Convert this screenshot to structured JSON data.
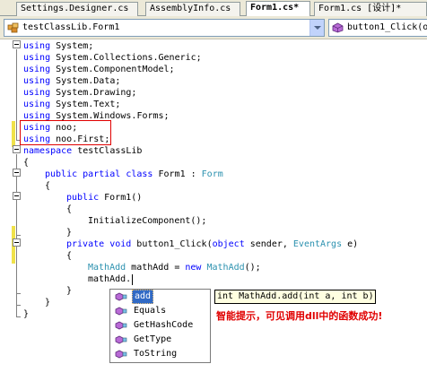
{
  "tabs": [
    {
      "label": "Settings.Designer.cs",
      "active": false
    },
    {
      "label": "AssemblyInfo.cs",
      "active": false
    },
    {
      "label": "Form1.cs*",
      "active": true
    },
    {
      "label": "Form1.cs [设计]*",
      "active": false
    }
  ],
  "navbar": {
    "class_combo": "testClassLib.Form1",
    "member_combo": "button1_Click(o"
  },
  "code": {
    "l1": [
      "using",
      " System;"
    ],
    "l2": [
      "using",
      " System.Collections.Generic;"
    ],
    "l3": [
      "using",
      " System.ComponentModel;"
    ],
    "l4": [
      "using",
      " System.Data;"
    ],
    "l5": [
      "using",
      " System.Drawing;"
    ],
    "l6": [
      "using",
      " System.Text;"
    ],
    "l7": [
      "using",
      " System.Windows.Forms;"
    ],
    "l8": [
      "using",
      " noo;"
    ],
    "l9": [
      "using",
      " noo.First;"
    ],
    "l10": [
      "namespace",
      " testClassLib"
    ],
    "l11": "{",
    "l12": [
      "public",
      "partial",
      "class",
      "Form1",
      "Form"
    ],
    "l13": "{",
    "l14": [
      "public",
      " Form1()"
    ],
    "l15": "{",
    "l16": "InitializeComponent();",
    "l17": "}",
    "l18": [
      "private",
      "void",
      " button1_Click(",
      "object",
      " sender, ",
      "EventArgs",
      " e)"
    ],
    "l19": "{",
    "l20": [
      "MathAdd",
      " mathAdd = ",
      "new",
      "MathAdd",
      "();"
    ],
    "l21": "mathAdd.",
    "l22": "}",
    "l23": "}",
    "l24": "}"
  },
  "intellisense": {
    "items": [
      "add",
      "Equals",
      "GetHashCode",
      "GetType",
      "ToString"
    ],
    "selected_index": 0,
    "tooltip": "int MathAdd.add(int a, int b)"
  },
  "annotation": "智能提示，可见调用dll中的函数成功!",
  "colors": {
    "keyword": "#0000ff",
    "type": "#2b91af",
    "highlight_box": "#e00000",
    "selection": "#316ac5",
    "tooltip_bg": "#ffffe1",
    "change_bar": "#f0e24a"
  }
}
